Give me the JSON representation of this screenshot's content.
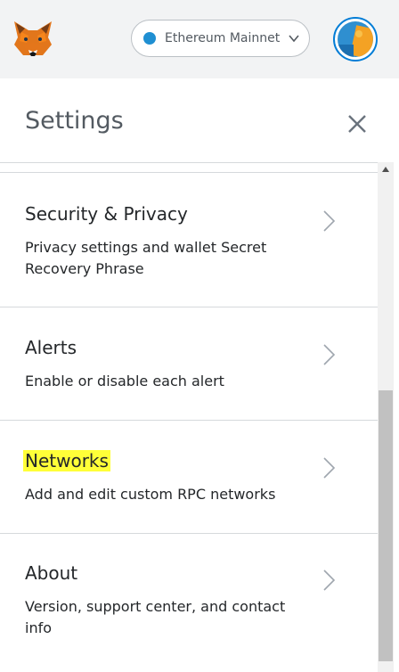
{
  "topbar": {
    "logo_icon": "metamask-fox-icon",
    "network": {
      "label": "Ethereum Mainnet",
      "dot_color": "#1f8fd2"
    },
    "account_icon": "account-avatar-icon"
  },
  "header": {
    "title": "Settings",
    "close_icon": "close-icon"
  },
  "settings_items": [
    {
      "title": "Security & Privacy",
      "description": "Privacy settings and wallet Secret Recovery Phrase"
    },
    {
      "title": "Alerts",
      "description": "Enable or disable each alert"
    },
    {
      "title": "Networks",
      "description": "Add and edit custom RPC networks",
      "highlight_color": "#ffff38"
    },
    {
      "title": "About",
      "description": "Version, support center, and contact info"
    }
  ]
}
